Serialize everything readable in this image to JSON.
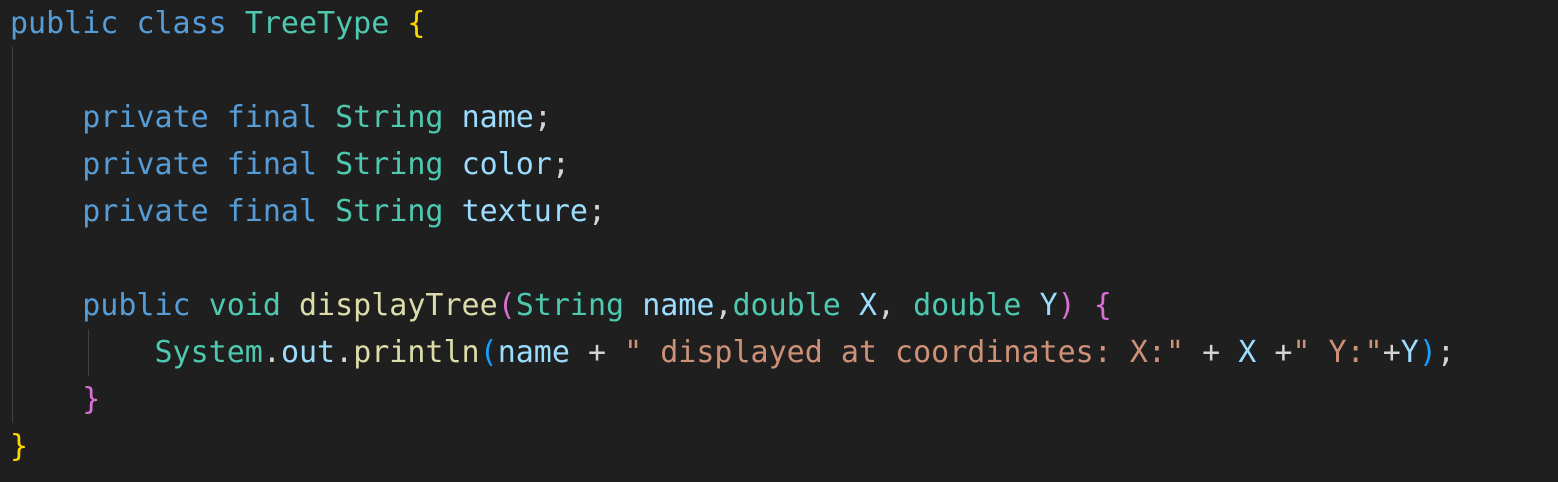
{
  "editor": {
    "language": "Java",
    "theme_colors": {
      "background": "#1f1f1f",
      "keyword": "#569cd6",
      "type": "#4ec9b0",
      "variable": "#9cdcfe",
      "function": "#dcdcaa",
      "string": "#ce9178",
      "punctuation": "#d4d4d4",
      "bracket_level1": "#ffd700",
      "bracket_level2": "#da70d6",
      "bracket_level3": "#179fff"
    },
    "lines": [
      [
        {
          "t": "public",
          "c": "kw"
        },
        {
          "t": " ",
          "c": "pun"
        },
        {
          "t": "class",
          "c": "kw"
        },
        {
          "t": " ",
          "c": "pun"
        },
        {
          "t": "TreeType",
          "c": "type"
        },
        {
          "t": " ",
          "c": "pun"
        },
        {
          "t": "{",
          "c": "b1"
        }
      ],
      [],
      [
        {
          "t": "    ",
          "c": "pun"
        },
        {
          "t": "private",
          "c": "kw"
        },
        {
          "t": " ",
          "c": "pun"
        },
        {
          "t": "final",
          "c": "kw"
        },
        {
          "t": " ",
          "c": "pun"
        },
        {
          "t": "String",
          "c": "type"
        },
        {
          "t": " ",
          "c": "pun"
        },
        {
          "t": "name",
          "c": "var"
        },
        {
          "t": ";",
          "c": "pun"
        }
      ],
      [
        {
          "t": "    ",
          "c": "pun"
        },
        {
          "t": "private",
          "c": "kw"
        },
        {
          "t": " ",
          "c": "pun"
        },
        {
          "t": "final",
          "c": "kw"
        },
        {
          "t": " ",
          "c": "pun"
        },
        {
          "t": "String",
          "c": "type"
        },
        {
          "t": " ",
          "c": "pun"
        },
        {
          "t": "color",
          "c": "var"
        },
        {
          "t": ";",
          "c": "pun"
        }
      ],
      [
        {
          "t": "    ",
          "c": "pun"
        },
        {
          "t": "private",
          "c": "kw"
        },
        {
          "t": " ",
          "c": "pun"
        },
        {
          "t": "final",
          "c": "kw"
        },
        {
          "t": " ",
          "c": "pun"
        },
        {
          "t": "String",
          "c": "type"
        },
        {
          "t": " ",
          "c": "pun"
        },
        {
          "t": "texture",
          "c": "var"
        },
        {
          "t": ";",
          "c": "pun"
        }
      ],
      [],
      [
        {
          "t": "    ",
          "c": "pun"
        },
        {
          "t": "public",
          "c": "kw"
        },
        {
          "t": " ",
          "c": "pun"
        },
        {
          "t": "void",
          "c": "type"
        },
        {
          "t": " ",
          "c": "pun"
        },
        {
          "t": "displayTree",
          "c": "fn"
        },
        {
          "t": "(",
          "c": "b2"
        },
        {
          "t": "String",
          "c": "type"
        },
        {
          "t": " ",
          "c": "pun"
        },
        {
          "t": "name",
          "c": "var"
        },
        {
          "t": ",",
          "c": "pun"
        },
        {
          "t": "double",
          "c": "type"
        },
        {
          "t": " ",
          "c": "pun"
        },
        {
          "t": "X",
          "c": "var"
        },
        {
          "t": ", ",
          "c": "pun"
        },
        {
          "t": "double",
          "c": "type"
        },
        {
          "t": " ",
          "c": "pun"
        },
        {
          "t": "Y",
          "c": "var"
        },
        {
          "t": ")",
          "c": "b2"
        },
        {
          "t": " ",
          "c": "pun"
        },
        {
          "t": "{",
          "c": "b2"
        }
      ],
      [
        {
          "t": "        ",
          "c": "pun"
        },
        {
          "t": "System",
          "c": "type"
        },
        {
          "t": ".",
          "c": "pun"
        },
        {
          "t": "out",
          "c": "var"
        },
        {
          "t": ".",
          "c": "pun"
        },
        {
          "t": "println",
          "c": "fn"
        },
        {
          "t": "(",
          "c": "b3"
        },
        {
          "t": "name",
          "c": "var"
        },
        {
          "t": " + ",
          "c": "pun"
        },
        {
          "t": "\" displayed at coordinates: X:\"",
          "c": "str"
        },
        {
          "t": " + ",
          "c": "pun"
        },
        {
          "t": "X",
          "c": "var"
        },
        {
          "t": " +",
          "c": "pun"
        },
        {
          "t": "\" Y:\"",
          "c": "str"
        },
        {
          "t": "+",
          "c": "pun"
        },
        {
          "t": "Y",
          "c": "var"
        },
        {
          "t": ")",
          "c": "b3"
        },
        {
          "t": ";",
          "c": "pun"
        }
      ],
      [
        {
          "t": "    ",
          "c": "pun"
        },
        {
          "t": "}",
          "c": "b2"
        }
      ],
      [
        {
          "t": "}",
          "c": "b1"
        }
      ]
    ]
  }
}
